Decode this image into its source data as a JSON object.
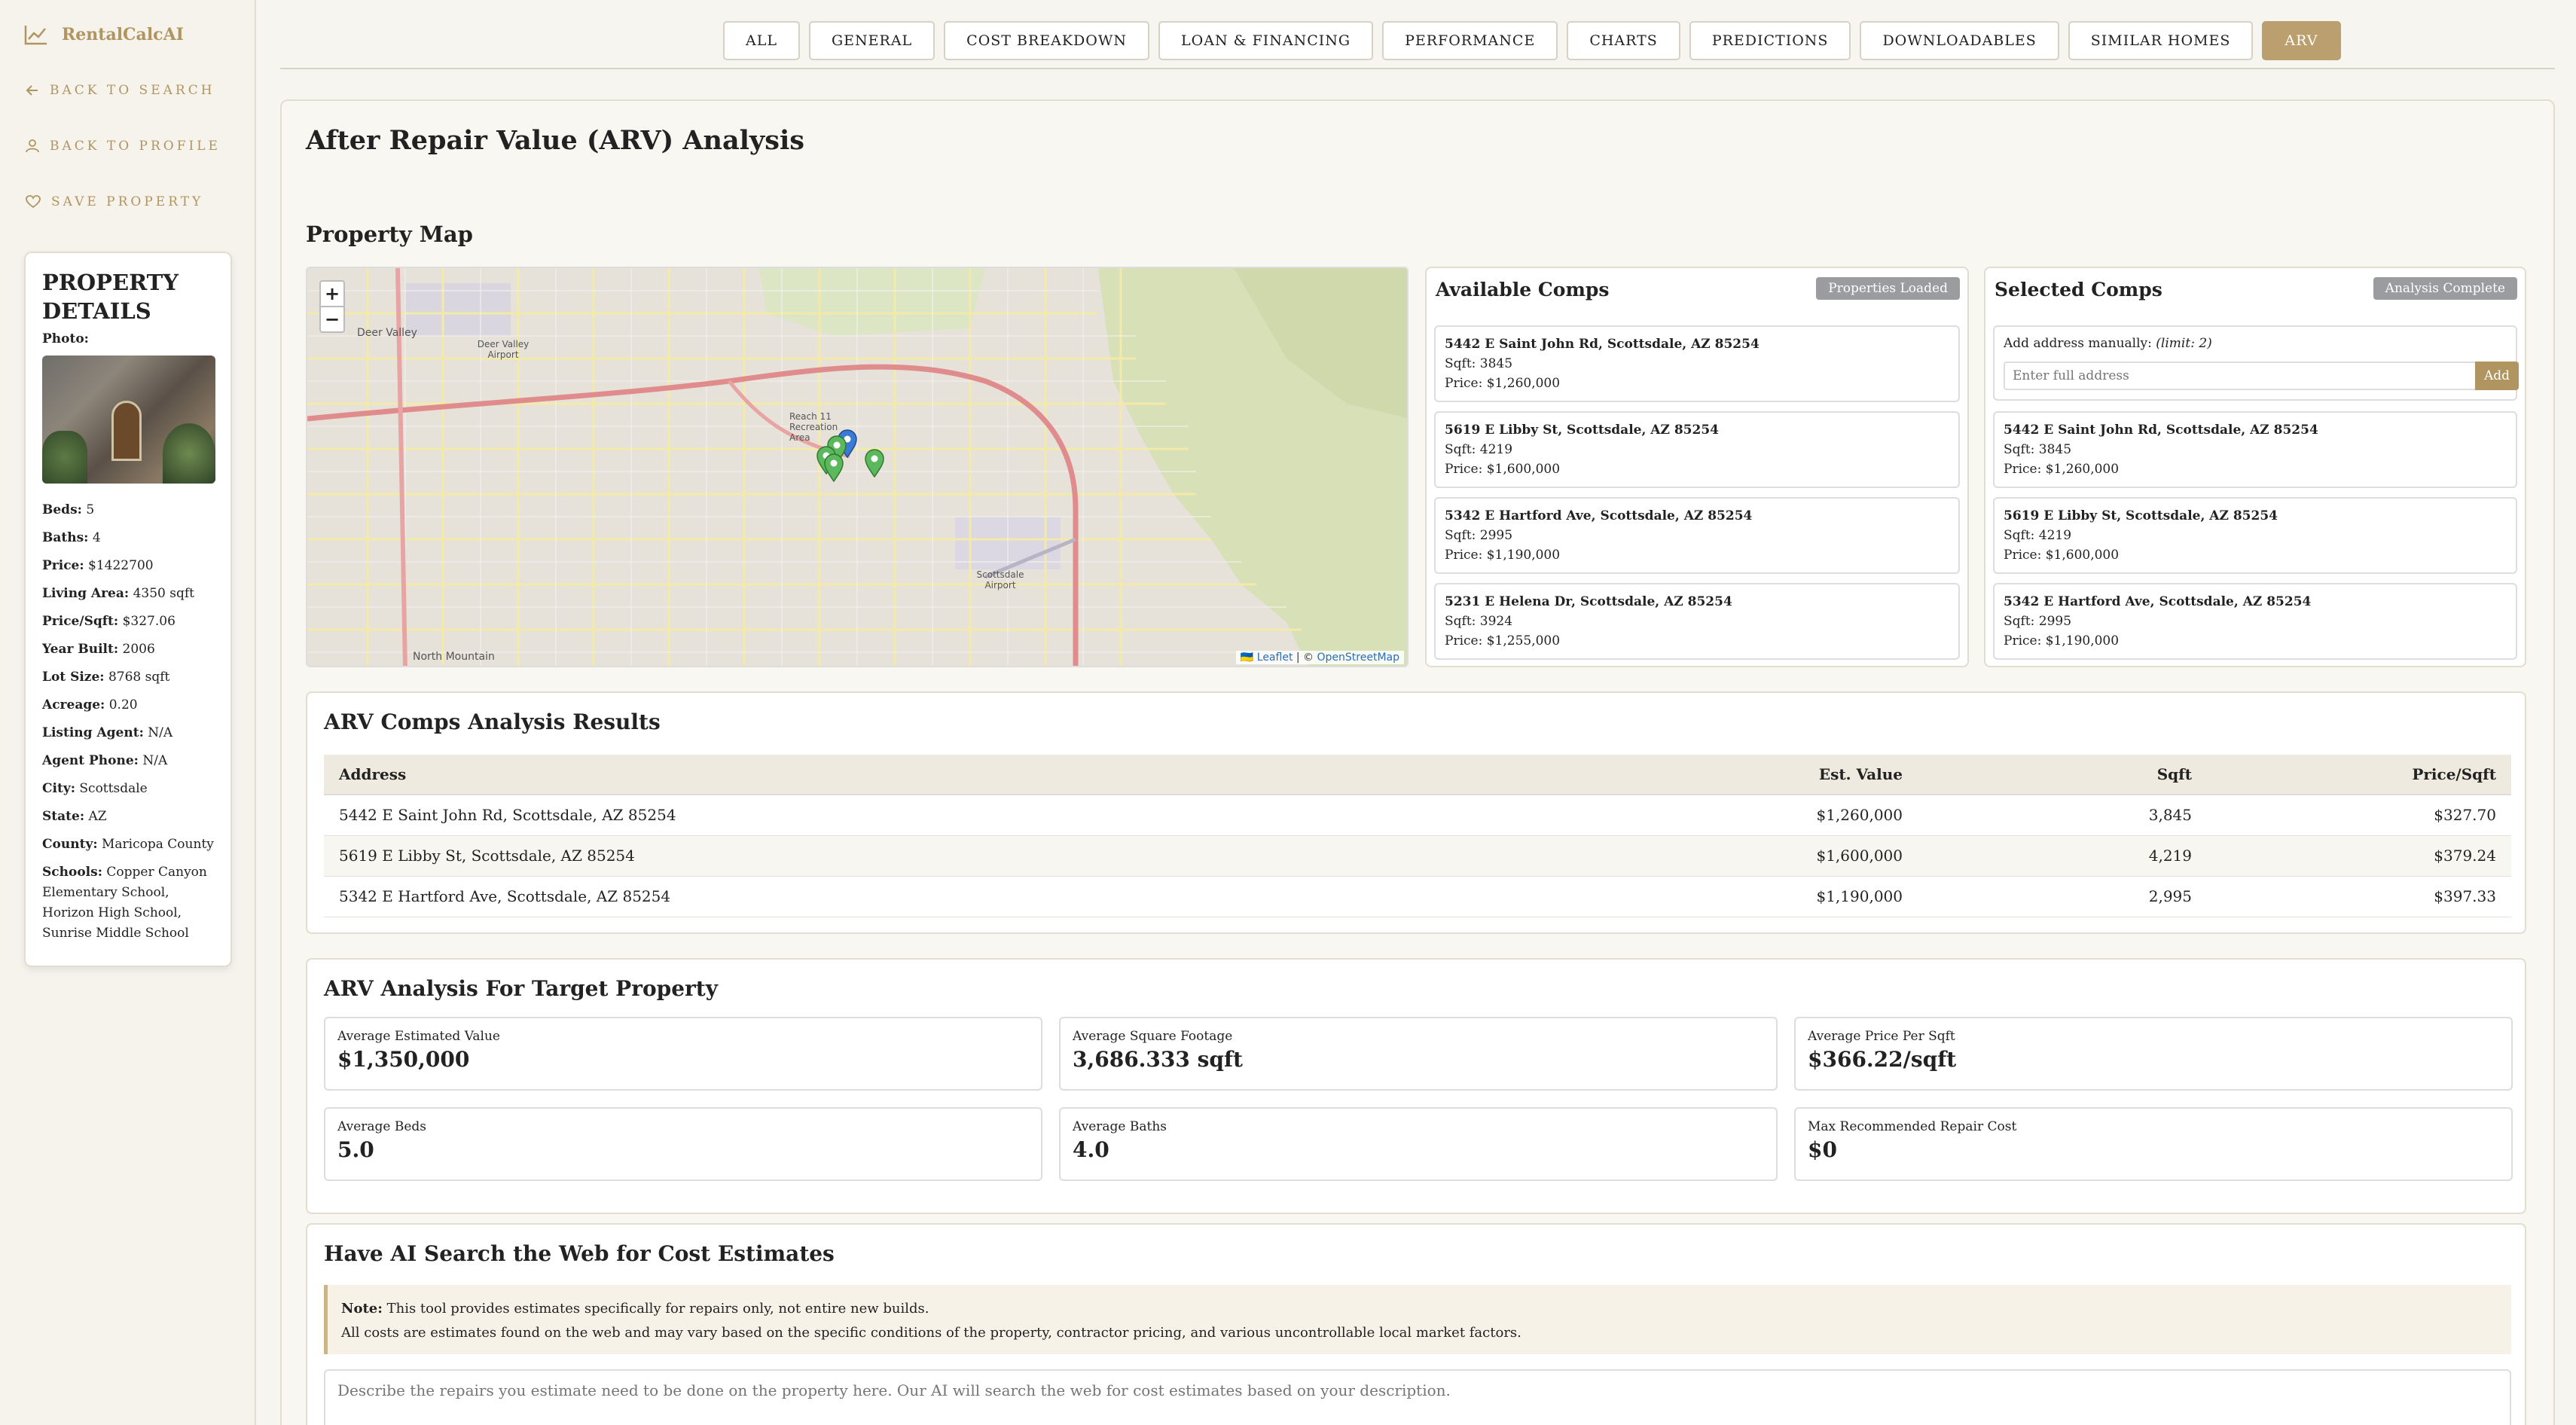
{
  "app": {
    "name": "RentalCalcAI"
  },
  "sidebar": {
    "links": [
      {
        "label": "Back to Search",
        "icon": "arrow-left-icon"
      },
      {
        "label": "Back to Profile",
        "icon": "user-icon"
      },
      {
        "label": "Save Property",
        "icon": "heart-icon"
      }
    ],
    "card": {
      "title": "PROPERTY DETAILS",
      "photo_label": "Photo:",
      "details": [
        {
          "label": "Beds:",
          "value": "5"
        },
        {
          "label": "Baths:",
          "value": "4"
        },
        {
          "label": "Price:",
          "value": "$1422700"
        },
        {
          "label": "Living Area:",
          "value": "4350 sqft"
        },
        {
          "label": "Price/Sqft:",
          "value": "$327.06"
        },
        {
          "label": "Year Built:",
          "value": "2006"
        },
        {
          "label": "Lot Size:",
          "value": "8768 sqft"
        },
        {
          "label": "Acreage:",
          "value": "0.20"
        },
        {
          "label": "Listing Agent:",
          "value": "N/A"
        },
        {
          "label": "Agent Phone:",
          "value": "N/A"
        },
        {
          "label": "City:",
          "value": "Scottsdale"
        },
        {
          "label": "State:",
          "value": "AZ"
        },
        {
          "label": "County:",
          "value": "Maricopa County"
        },
        {
          "label": "Schools:",
          "value": "Copper Canyon Elementary School, Horizon High School, Sunrise Middle School"
        }
      ]
    }
  },
  "tabs": [
    "ALL",
    "GENERAL",
    "COST BREAKDOWN",
    "LOAN & FINANCING",
    "PERFORMANCE",
    "CHARTS",
    "PREDICTIONS",
    "DOWNLOADABLES",
    "SIMILAR HOMES",
    "ARV"
  ],
  "active_tab": "ARV",
  "page": {
    "title": "After Repair Value (ARV) Analysis",
    "map_title": "Property Map"
  },
  "map": {
    "zoom_in": "+",
    "zoom_out": "−",
    "labels": [
      "Deer Valley",
      "Deer Valley Airport",
      "North Mountain",
      "Scottsdale Airport",
      "Reach 11 Recreation Area"
    ],
    "attribution_leaflet": "Leaflet",
    "attribution_sep": " | © ",
    "attribution_osm": "OpenStreetMap",
    "flag": "🇺🇦"
  },
  "available": {
    "title": "Available Comps",
    "badge": "Properties Loaded",
    "comps": [
      {
        "address": "5442 E Saint John Rd, Scottsdale, AZ 85254",
        "sqft": "Sqft: 3845",
        "price": "Price: $1,260,000"
      },
      {
        "address": "5619 E Libby St, Scottsdale, AZ 85254",
        "sqft": "Sqft: 4219",
        "price": "Price: $1,600,000"
      },
      {
        "address": "5342 E Hartford Ave, Scottsdale, AZ 85254",
        "sqft": "Sqft: 2995",
        "price": "Price: $1,190,000"
      },
      {
        "address": "5231 E Helena Dr, Scottsdale, AZ 85254",
        "sqft": "Sqft: 3924",
        "price": "Price: $1,255,000"
      }
    ]
  },
  "selected": {
    "title": "Selected Comps",
    "badge": "Analysis Complete",
    "add_label": "Add address manually:",
    "add_limit": "(limit: 2)",
    "add_placeholder": "Enter full address",
    "add_button": "Add",
    "comps": [
      {
        "address": "5442 E Saint John Rd, Scottsdale, AZ 85254",
        "sqft": "Sqft: 3845",
        "price": "Price: $1,260,000"
      },
      {
        "address": "5619 E Libby St, Scottsdale, AZ 85254",
        "sqft": "Sqft: 4219",
        "price": "Price: $1,600,000"
      },
      {
        "address": "5342 E Hartford Ave, Scottsdale, AZ 85254",
        "sqft": "Sqft: 2995",
        "price": "Price: $1,190,000"
      }
    ]
  },
  "results": {
    "title": "ARV Comps Analysis Results",
    "headers": [
      "Address",
      "Est. Value",
      "Sqft",
      "Price/Sqft"
    ],
    "rows": [
      [
        "5442 E Saint John Rd, Scottsdale, AZ 85254",
        "$1,260,000",
        "3,845",
        "$327.70"
      ],
      [
        "5619 E Libby St, Scottsdale, AZ 85254",
        "$1,600,000",
        "4,219",
        "$379.24"
      ],
      [
        "5342 E Hartford Ave, Scottsdale, AZ 85254",
        "$1,190,000",
        "2,995",
        "$397.33"
      ]
    ]
  },
  "arv": {
    "title": "ARV Analysis For Target Property",
    "stats": [
      {
        "label": "Average Estimated Value",
        "value": "$1,350,000"
      },
      {
        "label": "Average Square Footage",
        "value": "3,686.333 sqft"
      },
      {
        "label": "Average Price Per Sqft",
        "value": "$366.22/sqft"
      },
      {
        "label": "Average Beds",
        "value": "5.0"
      },
      {
        "label": "Average Baths",
        "value": "4.0"
      },
      {
        "label": "Max Recommended Repair Cost",
        "value": "$0"
      }
    ]
  },
  "ai": {
    "title": "Have AI Search the Web for Cost Estimates",
    "note_label": "Note:",
    "note_line1": "This tool provides estimates specifically for repairs only, not entire new builds.",
    "note_line2": "All costs are estimates found on the web and may vary based on the specific conditions of the property, contractor pricing, and various uncontrollable local market factors.",
    "placeholder": "Describe the repairs you estimate need to be done on the property here. Our AI will search the web for cost estimates based on your description."
  },
  "colors": {
    "accent": "#b19560",
    "active_tab": "#bb9f6e",
    "badge": "#9a9ca0",
    "marker_green": "#5cb85c",
    "marker_blue": "#3a7bd5"
  }
}
